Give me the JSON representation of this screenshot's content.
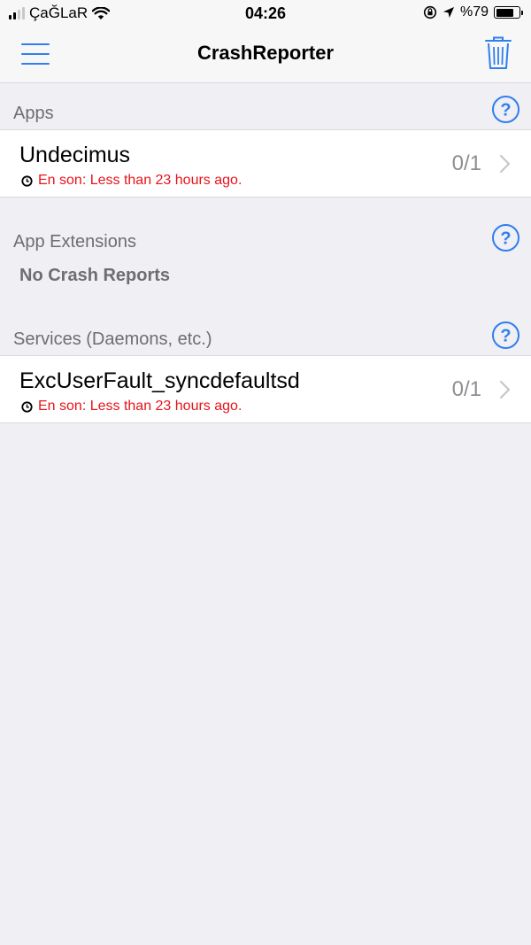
{
  "status_bar": {
    "carrier": "ÇaĞLaR",
    "time": "04:26",
    "battery_text": "%79",
    "battery_level": 0.79,
    "icons": [
      "signal-icon",
      "wifi-icon",
      "orientation-lock-icon",
      "location-arrow-icon",
      "battery-icon"
    ]
  },
  "nav": {
    "title": "CrashReporter",
    "left_icon": "hamburger-menu-icon",
    "right_icon": "trash-icon"
  },
  "sections": {
    "apps": {
      "title": "Apps",
      "help_label": "?",
      "rows": [
        {
          "name": "Undecimus",
          "subtitle": "En son: Less than 23 hours ago.",
          "count": "0/1"
        }
      ]
    },
    "extensions": {
      "title": "App Extensions",
      "help_label": "?",
      "empty_text": "No Crash Reports"
    },
    "services": {
      "title": "Services (Daemons, etc.)",
      "help_label": "?",
      "rows": [
        {
          "name": "ExcUserFault_syncdefaultsd",
          "subtitle": "En son: Less than 23 hours ago.",
          "count": "0/1"
        }
      ]
    }
  },
  "colors": {
    "accent": "#2f7ff0",
    "subtitle_red": "#e8131b",
    "background": "#efeff4",
    "section_text": "#6d6d72"
  }
}
